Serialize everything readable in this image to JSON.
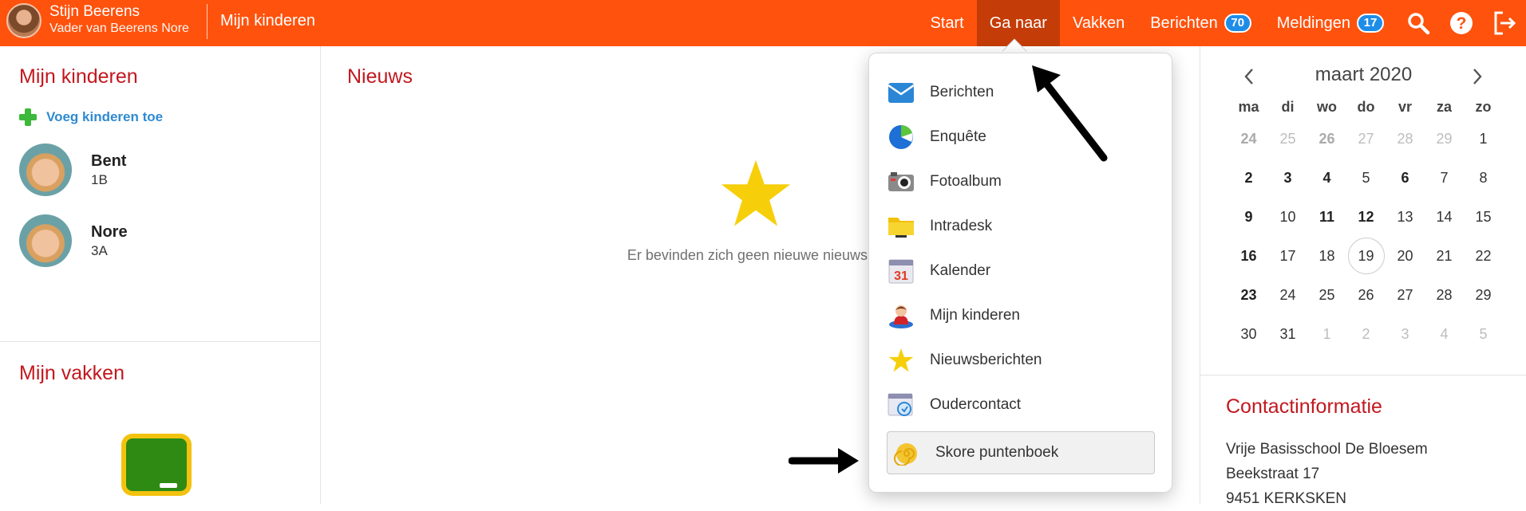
{
  "header": {
    "user_name": "Stijn Beerens",
    "user_role": "Vader van Beerens Nore",
    "page_title": "Mijn kinderen",
    "nav": {
      "start": "Start",
      "ga_naar": "Ga naar",
      "vakken": "Vakken",
      "berichten": "Berichten",
      "berichten_count": "70",
      "meldingen": "Meldingen",
      "meldingen_count": "17"
    },
    "icons": [
      "search-icon",
      "help-icon",
      "logout-icon"
    ],
    "bar_color": "#ff520d"
  },
  "left": {
    "title": "Mijn kinderen",
    "add_children": "Voeg kinderen toe",
    "children": [
      {
        "name": "Bent",
        "class": "1B"
      },
      {
        "name": "Nore",
        "class": "3A"
      }
    ],
    "subjects_title": "Mijn vakken"
  },
  "news": {
    "title": "Nieuws",
    "empty_text": "Er bevinden zich geen nieuwe nieuwsberichten in"
  },
  "dropdown": {
    "items": [
      {
        "label": "Berichten",
        "icon": "envelope-icon"
      },
      {
        "label": "Enquête",
        "icon": "pie-chart-icon"
      },
      {
        "label": "Fotoalbum",
        "icon": "camera-icon"
      },
      {
        "label": "Intradesk",
        "icon": "folder-icon"
      },
      {
        "label": "Kalender",
        "icon": "calendar-icon",
        "icon_text": "31"
      },
      {
        "label": "Mijn kinderen",
        "icon": "child-icon"
      },
      {
        "label": "Nieuwsberichten",
        "icon": "star-icon"
      },
      {
        "label": "Oudercontact",
        "icon": "oudercontact-icon"
      },
      {
        "label": "Skore puntenboek",
        "icon": "snail-shell-icon"
      }
    ]
  },
  "calendar": {
    "month": "maart 2020",
    "weekdays": [
      "ma",
      "di",
      "wo",
      "do",
      "vr",
      "za",
      "zo"
    ],
    "weeks": [
      [
        "24",
        "25",
        "26",
        "27",
        "28",
        "29",
        "1"
      ],
      [
        "2",
        "3",
        "4",
        "5",
        "6",
        "7",
        "8"
      ],
      [
        "9",
        "10",
        "11",
        "12",
        "13",
        "14",
        "15"
      ],
      [
        "16",
        "17",
        "18",
        "19",
        "20",
        "21",
        "22"
      ],
      [
        "23",
        "24",
        "25",
        "26",
        "27",
        "28",
        "29"
      ],
      [
        "30",
        "31",
        "1",
        "2",
        "3",
        "4",
        "5"
      ]
    ],
    "today": "19"
  },
  "contact": {
    "title": "Contactinformatie",
    "lines": [
      "Vrije Basisschool De Bloesem",
      "Beekstraat 17",
      "9451 KERKSKEN"
    ]
  }
}
